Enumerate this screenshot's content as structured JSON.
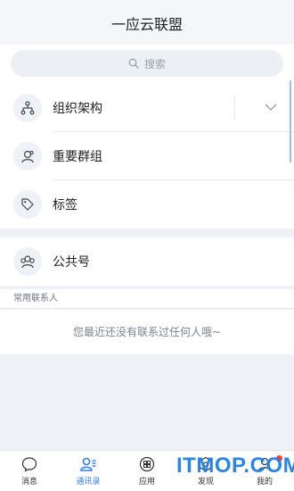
{
  "header": {
    "title": "一应云联盟"
  },
  "search": {
    "placeholder": "搜索",
    "icon": "search-icon"
  },
  "menu": [
    {
      "label": "组织架构",
      "icon": "org-chart-icon",
      "expandable": true
    },
    {
      "label": "重要群组",
      "icon": "group-icon"
    },
    {
      "label": "标签",
      "icon": "tag-icon"
    },
    {
      "label": "公共号",
      "icon": "public-account-icon"
    }
  ],
  "contacts": {
    "section_title": "常用联系人",
    "empty_text": "您最近还没有联系过任何人哦~"
  },
  "tabbar": {
    "items": [
      {
        "label": "消息",
        "icon": "message-icon"
      },
      {
        "label": "通讯录",
        "icon": "contacts-icon",
        "active": true
      },
      {
        "label": "应用",
        "icon": "apps-icon"
      },
      {
        "label": "发现",
        "icon": "discover-icon"
      },
      {
        "label": "我的",
        "icon": "profile-icon",
        "badge": true
      }
    ]
  },
  "watermark": {
    "text": "ITMOP.COM"
  },
  "colors": {
    "accent": "#2b7fff",
    "badge": "#ff3b30"
  }
}
